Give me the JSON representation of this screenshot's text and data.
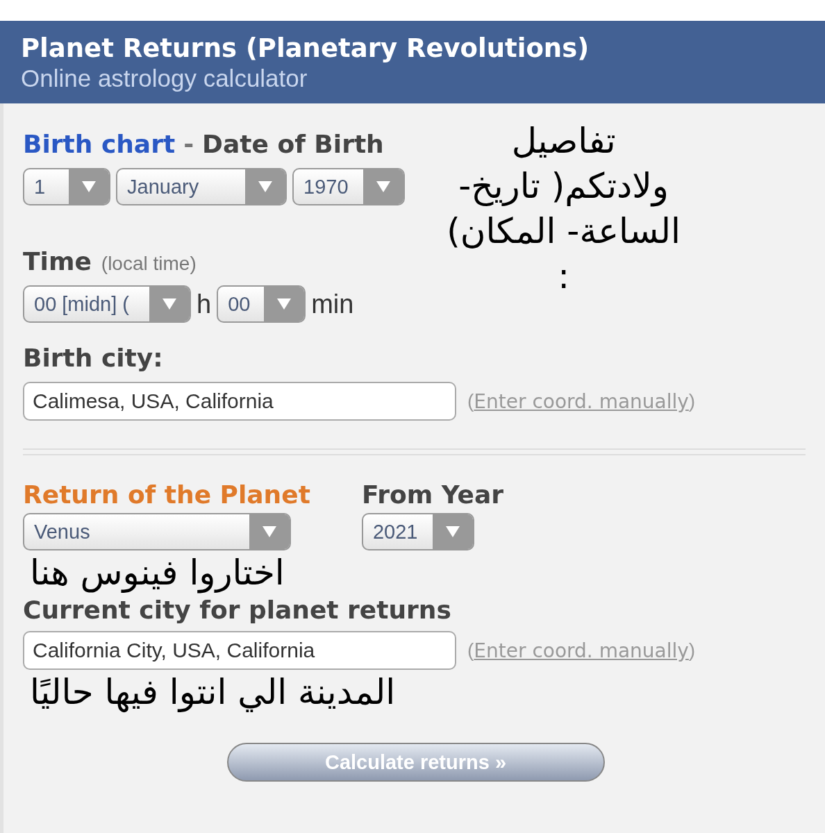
{
  "header": {
    "title": "Planet Returns (Planetary Revolutions)",
    "subtitle": "Online astrology calculator"
  },
  "birth": {
    "title_link": "Birth chart",
    "separator": "-",
    "title": "Date of Birth",
    "date_selects": [
      {
        "value": "1"
      },
      {
        "value": "January"
      },
      {
        "value": "1970"
      }
    ],
    "time_label": "Time",
    "time_hint": "(local time)",
    "hour_select": {
      "value": "00 [midn] ("
    },
    "hour_unit": "h",
    "minute_select": {
      "value": "00"
    },
    "minute_unit": "min",
    "city_label": "Birth city:",
    "city_value": "Calimesa, USA, California",
    "coord_link": {
      "open": "(",
      "label": "Enter coord. manually",
      "close": ")"
    },
    "note": "تفاصيل\nولادتكم( تاريخ-\nالساعة- المكان)\n:"
  },
  "returns": {
    "planet_label": "Return of the Planet",
    "planet_select": {
      "value": "Venus"
    },
    "year_label": "From Year",
    "year_select": {
      "value": "2021"
    },
    "planet_note": "اختاروا فينوس هنا",
    "city_label": "Current city for planet returns",
    "city_value": "California City, USA, California",
    "coord_link": {
      "open": "(",
      "label": "Enter coord. manually",
      "close": ")"
    },
    "city_note": "المدينة الي انتوا فيها حاليًا"
  },
  "submit": "Calculate returns »"
}
